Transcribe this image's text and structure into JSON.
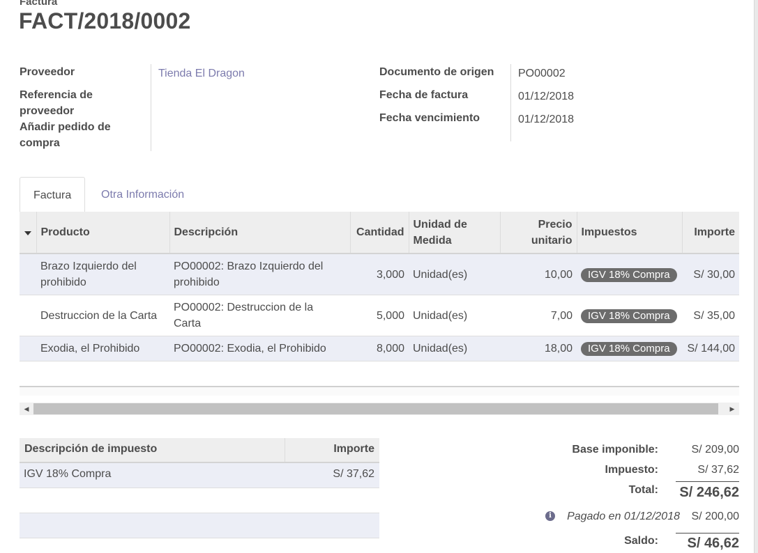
{
  "header": {
    "doc_type": "Factura",
    "number": "FACT/2018/0002"
  },
  "fields": {
    "proveedor_label": "Proveedor",
    "proveedor_value": "Tienda El Dragon",
    "referencia_label_1": "Referencia de",
    "referencia_label_2": "proveedor",
    "anadir_label_1": "Añadir pedido de",
    "anadir_label_2": "compra",
    "origen_label": "Documento de origen",
    "origen_value": "PO00002",
    "fecha_factura_label": "Fecha de factura",
    "fecha_factura_value": "01/12/2018",
    "fecha_venc_label": "Fecha vencimiento",
    "fecha_venc_value": "01/12/2018"
  },
  "tabs": [
    {
      "label": "Factura",
      "active": true
    },
    {
      "label": "Otra Información",
      "active": false
    }
  ],
  "lines_table": {
    "headers": {
      "producto": "Producto",
      "descripcion": "Descripción",
      "cantidad": "Cantidad",
      "unidad_1": "Unidad de",
      "unidad_2": "Medida",
      "precio_1": "Precio",
      "precio_2": "unitario",
      "impuestos": "Impuestos",
      "importe": "Importe"
    },
    "rows": [
      {
        "producto_1": "Brazo Izquierdo del",
        "producto_2": "prohibido",
        "descripcion_1": "PO00002: Brazo Izquierdo del",
        "descripcion_2": "prohibido",
        "cantidad": "3,000",
        "unidad": "Unidad(es)",
        "precio": "10,00",
        "impuesto": "IGV 18% Compra",
        "importe": "S/ 30,00"
      },
      {
        "producto_1": "Destruccion de la Carta",
        "producto_2": "",
        "descripcion_1": "PO00002: Destruccion de la",
        "descripcion_2": "Carta",
        "cantidad": "5,000",
        "unidad": "Unidad(es)",
        "precio": "7,00",
        "impuesto": "IGV 18% Compra",
        "importe": "S/ 35,00"
      },
      {
        "producto_1": "Exodia, el Prohibido",
        "producto_2": "",
        "descripcion_1": "PO00002: Exodia, el Prohibido",
        "descripcion_2": "",
        "cantidad": "8,000",
        "unidad": "Unidad(es)",
        "precio": "18,00",
        "impuesto": "IGV 18% Compra",
        "importe": "S/ 144,00"
      }
    ]
  },
  "tax_table": {
    "header_desc": "Descripción de impuesto",
    "header_importe": "Importe",
    "rows": [
      {
        "desc": "IGV 18% Compra",
        "importe": "S/ 37,62"
      }
    ]
  },
  "totals": {
    "base_label": "Base imponible:",
    "base_value": "S/ 209,00",
    "impuesto_label": "Impuesto:",
    "impuesto_value": "S/ 37,62",
    "total_label": "Total:",
    "total_value": "S/ 246,62",
    "pagado_label": "Pagado en 01/12/2018",
    "pagado_value": "S/ 200,00",
    "saldo_label": "Saldo:",
    "saldo_value": "S/ 46,62"
  },
  "icons": {
    "sort": "caret-down-icon",
    "info": "info-icon",
    "scroll_left": "arrow-left-icon",
    "scroll_right": "arrow-right-icon"
  },
  "colors": {
    "link": "#7c7bad",
    "badge": "#6c6c6c",
    "row_alt": "#eceef6",
    "header_bg": "#eeeeee"
  }
}
